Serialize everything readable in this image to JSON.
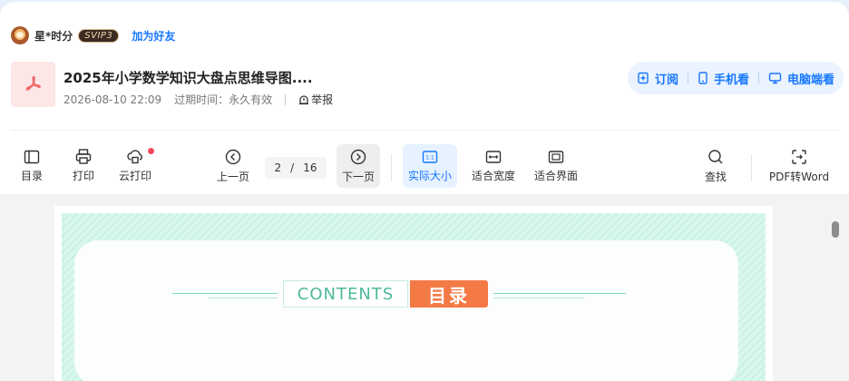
{
  "user": {
    "name": "星*时分",
    "vip": "SVIP3",
    "add_friend": "加为好友"
  },
  "doc": {
    "title": "2025年小学数学知识大盘点思维导图....",
    "date": "2026-08-10 22:09",
    "expiry": "过期时间：永久有效",
    "report": "举报"
  },
  "actions": {
    "subscribe": "订阅",
    "mobile": "手机看",
    "pc": "电脑端看"
  },
  "toolbar": {
    "toc": "目录",
    "print": "打印",
    "cloud_print": "云打印",
    "prev": "上一页",
    "page_current": "2",
    "page_sep": "/",
    "page_total": "16",
    "next": "下一页",
    "actual_size": "实际大小",
    "fit_width": "适合宽度",
    "fit_page": "适合界面",
    "find": "查找",
    "pdf_to_word": "PDF转Word"
  },
  "page_content": {
    "contents_en": "CONTENTS",
    "contents_cn": "目录"
  },
  "colors": {
    "accent": "#1677ff",
    "pdf_red": "#f06a6a",
    "mint": "#7ddcb7",
    "orange": "#f47a45"
  }
}
